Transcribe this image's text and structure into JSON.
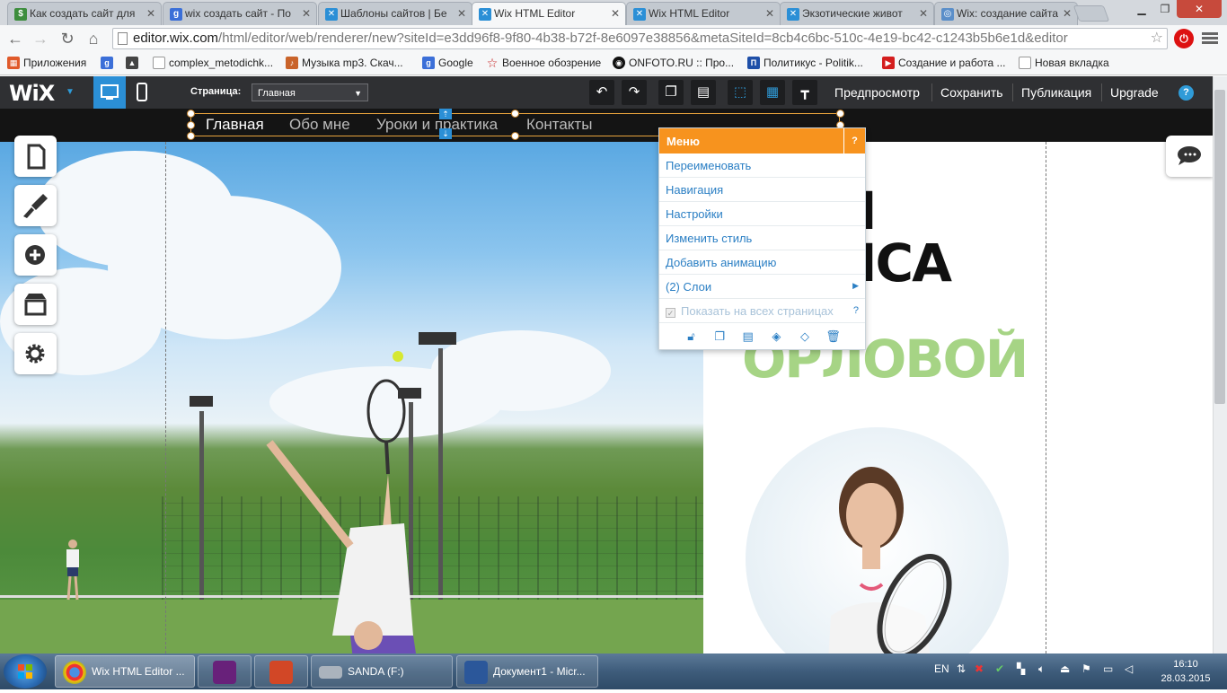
{
  "browser": {
    "tabs": [
      {
        "title": "Как создать сайт для",
        "icon_color": "#3d8d3d",
        "icon": "$"
      },
      {
        "title": "wix создать сайт - По",
        "icon_color": "#3b6fd8",
        "icon": "g"
      },
      {
        "title": "Шаблоны сайтов | Бе",
        "icon_color": "#2b8fd6",
        "icon": "✕"
      },
      {
        "title": "Wix HTML Editor",
        "icon_color": "#2b8fd6",
        "icon": "✕"
      },
      {
        "title": "Wix HTML Editor",
        "icon_color": "#2b8fd6",
        "icon": "✕"
      },
      {
        "title": "Экзотические живот",
        "icon_color": "#2b8fd6",
        "icon": "✕"
      },
      {
        "title": "Wix: создание сайта",
        "icon_color": "#5a8ec9",
        "icon": "◎"
      }
    ],
    "active_tab_index": 3,
    "url_host": "editor.wix.com",
    "url_path": "/html/editor/web/renderer/new?siteId=e3dd96f8-9f80-4b38-b72f-8e6097e38856&metaSiteId=8cb4c6bc-510c-4e19-bc42-c1243b5b6e1d&editor",
    "bookmarks": [
      {
        "label": "Приложения",
        "icon": "apps-icon"
      },
      {
        "label": "",
        "icon": "google-icon"
      },
      {
        "label": "",
        "icon": "cap-icon"
      },
      {
        "label": "complex_metodichk...",
        "icon": "page-icon"
      },
      {
        "label": "Музыка mp3. Скач...",
        "icon": "music-icon"
      },
      {
        "label": "Google",
        "icon": "google-icon"
      },
      {
        "label": "Военное обозрение",
        "icon": "star-icon"
      },
      {
        "label": "ONFOTO.RU :: Про...",
        "icon": "camera-icon"
      },
      {
        "label": "Политикус - Politik...",
        "icon": "p-icon"
      },
      {
        "label": "Создание и работа ...",
        "icon": "youtube-icon"
      },
      {
        "label": "Новая вкладка",
        "icon": "page-icon"
      }
    ]
  },
  "editor": {
    "logo": "WiX",
    "page_label": "Страница:",
    "page_value": "Главная",
    "actions": [
      "Предпросмотр",
      "Сохранить",
      "Публикация",
      "Upgrade"
    ],
    "help": "?"
  },
  "site": {
    "menu": [
      "Главная",
      "Обо мне",
      "Уроки и практика",
      "Контакты"
    ],
    "hero_line1": "И",
    "hero_line2": "ИСА",
    "hero_name": "ОРЛОВОЙ"
  },
  "context_menu": {
    "title": "Меню",
    "help": "?",
    "items": [
      "Переименовать",
      "Навигация",
      "Настройки",
      "Изменить стиль",
      "Добавить анимацию",
      "(2) Слои"
    ],
    "show_all_pages": "Показать на всех страницах",
    "show_all_help": "?"
  },
  "taskbar": {
    "items": [
      {
        "label": "Wix HTML Editor ...",
        "icon": "chrome-icon"
      },
      {
        "label": "",
        "icon": "visual-studio-icon"
      },
      {
        "label": "",
        "icon": "powerpoint-icon"
      },
      {
        "label": "SANDA (F:)",
        "icon": "drive-icon"
      },
      {
        "label": "Документ1 - Micr...",
        "icon": "word-icon"
      }
    ],
    "lang": "EN",
    "time": "16:10",
    "date": "28.03.2015"
  },
  "colors": {
    "accent": "#f7931e",
    "wix_blue": "#2b8fd6",
    "name_green": "#a6d485"
  }
}
